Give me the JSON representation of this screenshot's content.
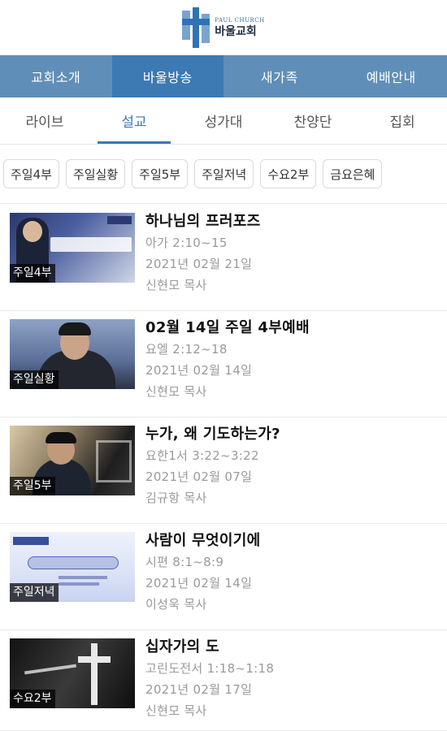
{
  "header": {
    "logo_en": "PAUL CHURCH",
    "logo_ko": "바울교회"
  },
  "main_nav": [
    "교회소개",
    "바울방송",
    "새가족",
    "예배안내"
  ],
  "sub_nav": [
    "라이브",
    "설교",
    "성가대",
    "찬양단",
    "집회"
  ],
  "filters": [
    "주일4부",
    "주일실황",
    "주일5부",
    "주일저녁",
    "수요2부",
    "금요은혜"
  ],
  "sermons": [
    {
      "tag": "주일4부",
      "title": "하나님의 프러포즈",
      "scripture": "아가 2:10~15",
      "date": "2021년 02월 21일",
      "pastor": "신현모 목사"
    },
    {
      "tag": "주일실황",
      "title": "02월 14일 주일 4부예배",
      "scripture": "요엘 2:12~18",
      "date": "2021년 02월 14일",
      "pastor": "신현모 목사"
    },
    {
      "tag": "주일5부",
      "title": "누가, 왜 기도하는가?",
      "scripture": "요한1서 3:22~3:22",
      "date": "2021년 02월 07일",
      "pastor": "김규항 목사"
    },
    {
      "tag": "주일저녁",
      "title": "사람이 무엇이기에",
      "scripture": "시편 8:1~8:9",
      "date": "2021년 02월 14일",
      "pastor": "이성욱 목사"
    },
    {
      "tag": "수요2부",
      "title": "십자가의 도",
      "scripture": "고린도전서 1:18~1:18",
      "date": "2021년 02월 17일",
      "pastor": "신현모 목사"
    }
  ],
  "colors": {
    "nav_bg": "#5f8fb8",
    "nav_active": "#3d79b3",
    "accent": "#3d79b3"
  }
}
